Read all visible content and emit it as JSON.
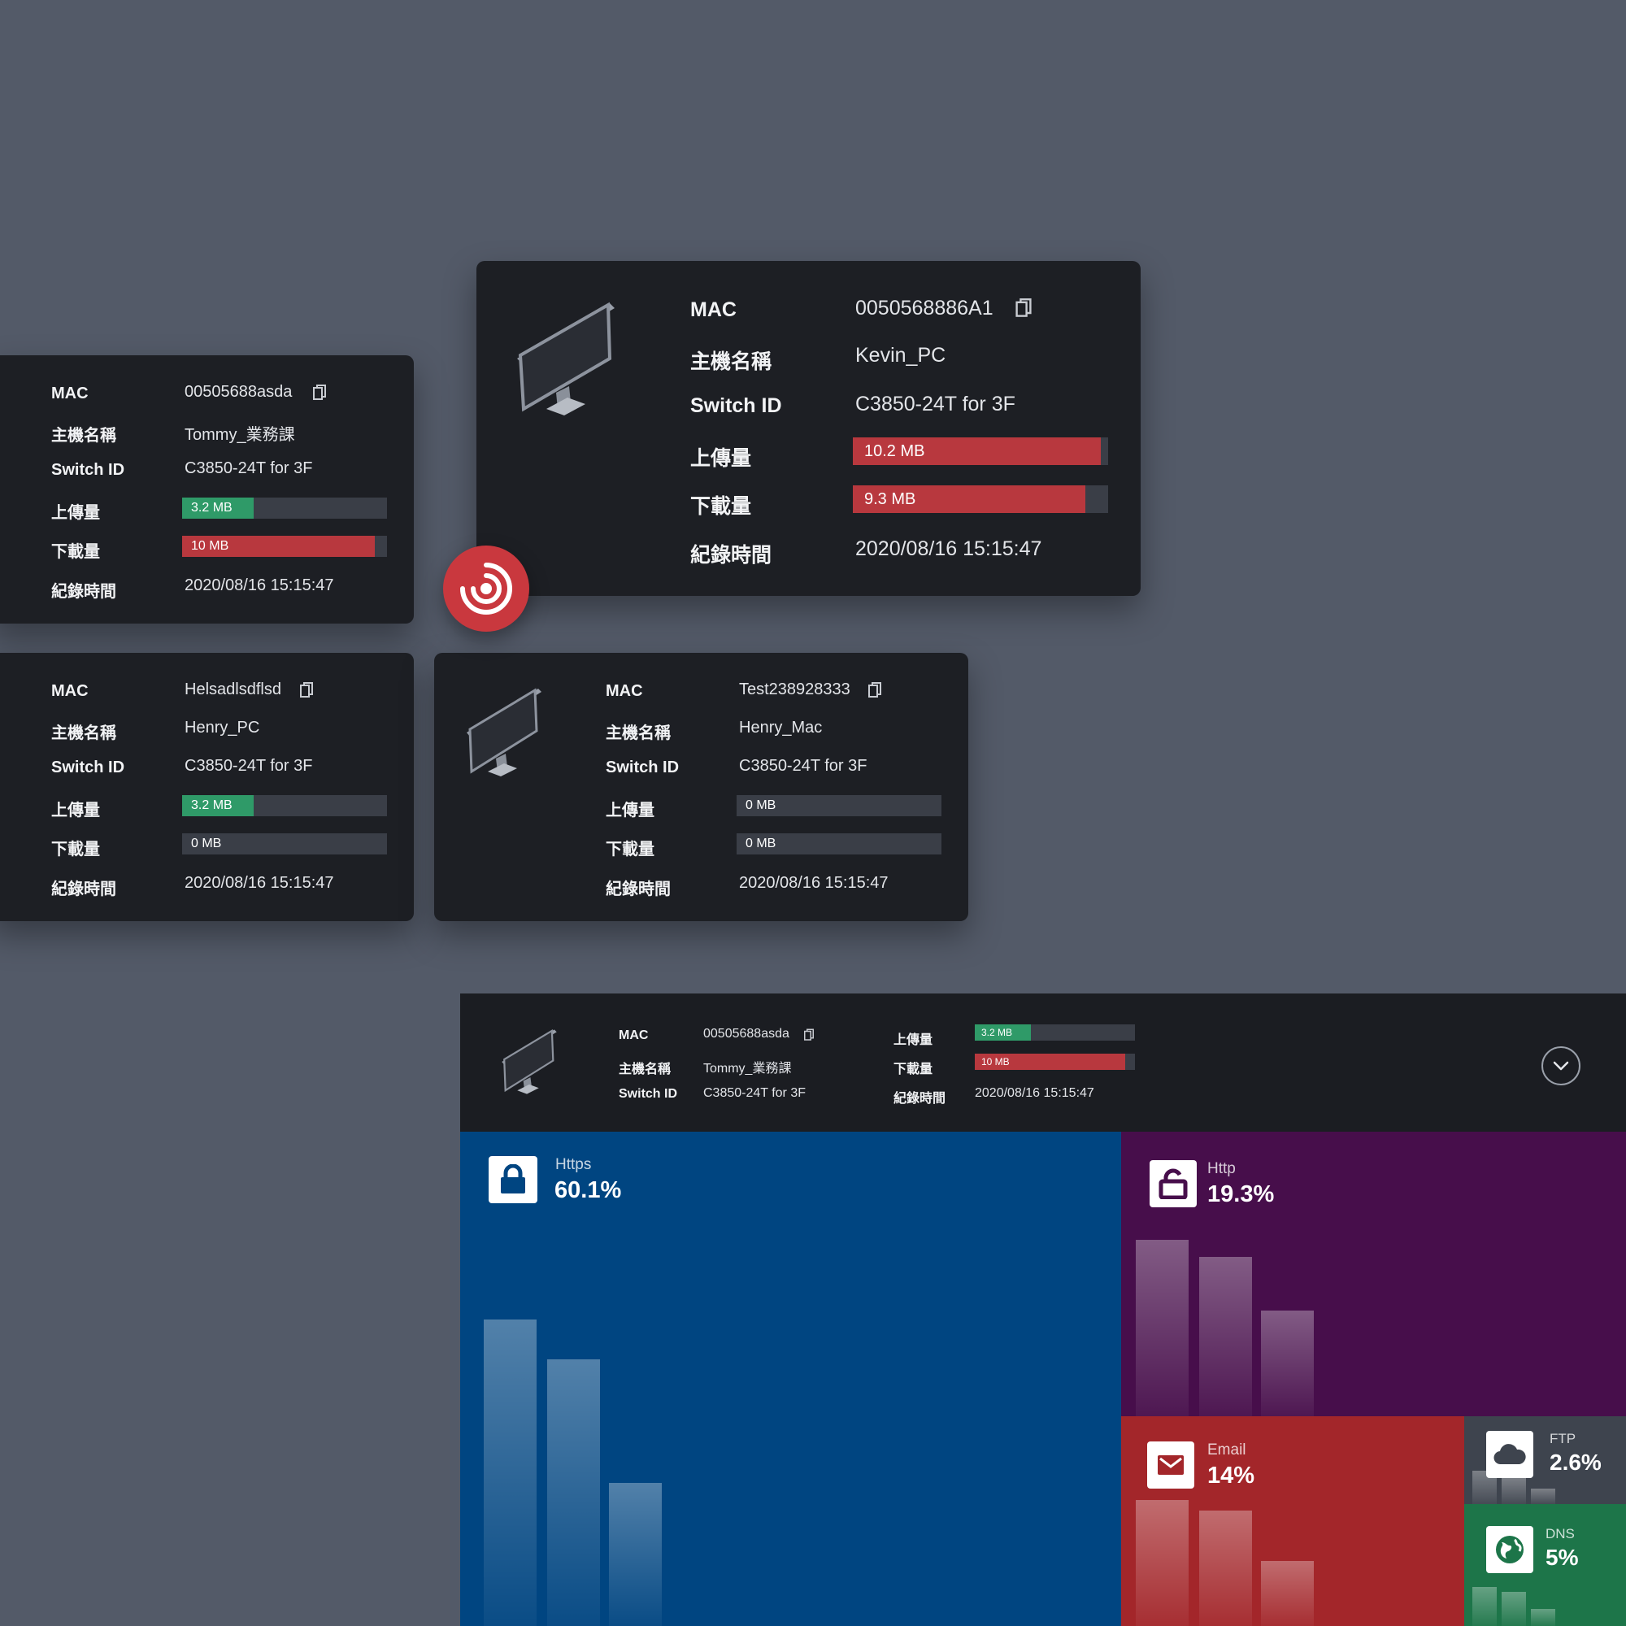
{
  "labels": {
    "mac": "MAC",
    "host": "主機名稱",
    "switch": "Switch ID",
    "upload": "上傳量",
    "download": "下載量",
    "time": "紀錄時間"
  },
  "main_card": {
    "mac": "0050568886A1",
    "host": "Kevin_PC",
    "switch": "C3850-24T for 3F",
    "upload": {
      "text": "10.2 MB",
      "fraction": 0.97,
      "status": "high"
    },
    "download": {
      "text": "9.3 MB",
      "fraction": 0.91,
      "status": "high"
    },
    "time": "2020/08/16 15:15:47"
  },
  "card_a": {
    "mac": "00505688asda",
    "host": "Tommy_業務課",
    "switch": "C3850-24T for 3F",
    "upload": {
      "text": "3.2 MB",
      "fraction": 0.35,
      "status": "normal"
    },
    "download": {
      "text": "10 MB",
      "fraction": 0.94,
      "status": "high"
    },
    "time": "2020/08/16 15:15:47"
  },
  "card_b": {
    "mac": "Helsadlsdflsd",
    "host": "Henry_PC",
    "switch": "C3850-24T for 3F",
    "upload": {
      "text": "3.2 MB",
      "fraction": 0.35,
      "status": "normal"
    },
    "download": {
      "text": "0 MB",
      "fraction": 0,
      "status": "none"
    },
    "time": "2020/08/16 15:15:47"
  },
  "card_c": {
    "mac": "Test238928333",
    "host": "Henry_Mac",
    "switch": "C3850-24T for 3F",
    "upload": {
      "text": "0 MB",
      "fraction": 0,
      "status": "none"
    },
    "download": {
      "text": "0 MB",
      "fraction": 0,
      "status": "none"
    },
    "time": "2020/08/16 15:15:47"
  },
  "panel": {
    "mac": "00505688asda",
    "host": "Tommy_業務課",
    "switch": "C3850-24T for 3F",
    "upload": {
      "text": "3.2 MB",
      "fraction": 0.35,
      "status": "normal"
    },
    "download": {
      "text": "10 MB",
      "fraction": 0.94,
      "status": "high"
    },
    "time": "2020/08/16 15:15:47",
    "toggle_icon": "chevron-down-icon"
  },
  "protocols": [
    {
      "name": "Https",
      "percent": "60.1%",
      "icon": "lock-icon",
      "color": "#004581",
      "bars": [
        0.62,
        0.54,
        0.29
      ]
    },
    {
      "name": "Http",
      "percent": "19.3%",
      "icon": "unlock-icon",
      "color": "#470e4b",
      "bars": [
        0.62,
        0.56,
        0.37
      ]
    },
    {
      "name": "Email",
      "percent": "14%",
      "icon": "mail-icon",
      "color": "#a3262a",
      "bars": [
        0.6,
        0.55,
        0.31
      ]
    },
    {
      "name": "FTP",
      "percent": "2.6%",
      "icon": "cloud-icon",
      "color": "#3e444e",
      "bars": [
        0.38,
        0.3,
        0.18
      ]
    },
    {
      "name": "DNS",
      "percent": "5%",
      "icon": "globe-icon",
      "color": "#1d7549",
      "bars": [
        0.32,
        0.28,
        0.14
      ]
    }
  ],
  "colors": {
    "green": "#2f9a68",
    "red": "#b8383e",
    "track": "#3a3e47",
    "card": "#1d1f24",
    "background": "#535a68",
    "alert": "#c9383e"
  },
  "alert_icon": "signal-broadcast-icon"
}
